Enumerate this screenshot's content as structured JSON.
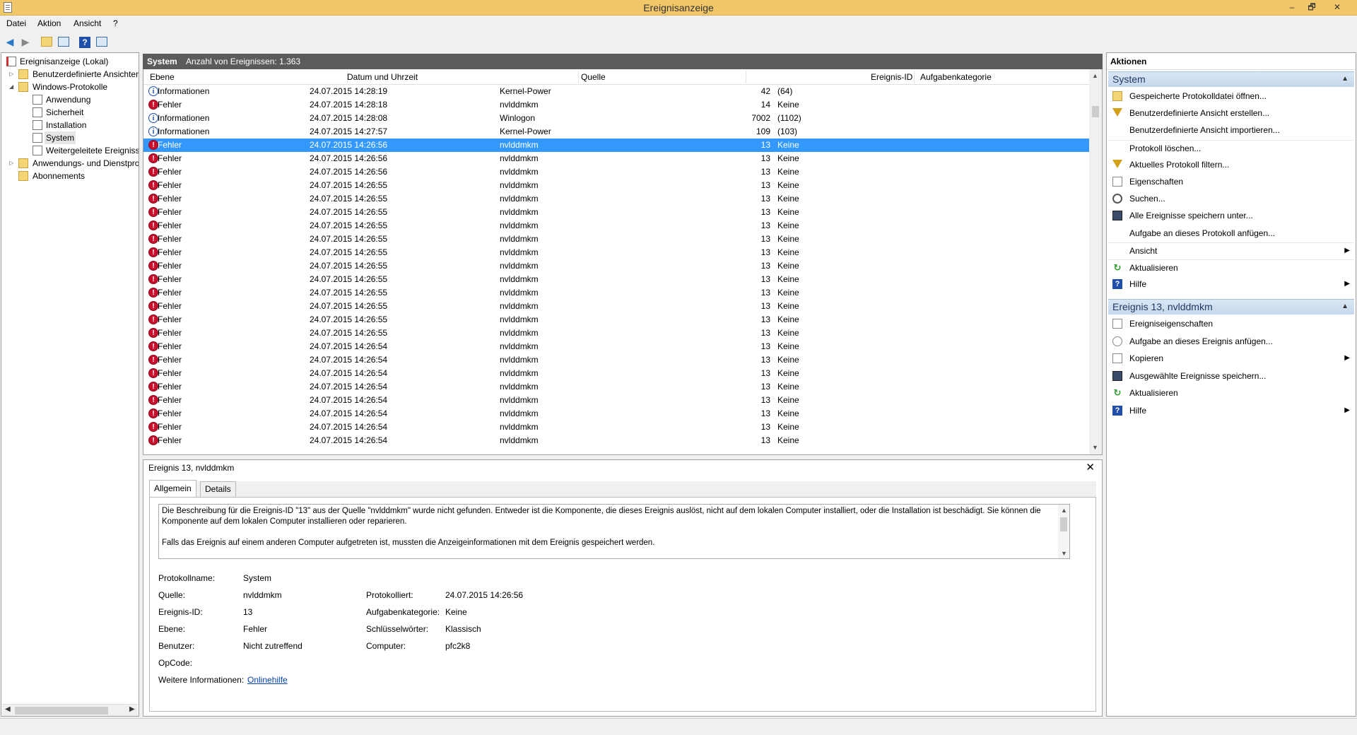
{
  "window": {
    "title": "Ereignisanzeige",
    "minimize": "–",
    "maximize": "🗗",
    "close": "✕"
  },
  "menu": [
    {
      "label": "Datei"
    },
    {
      "label": "Aktion"
    },
    {
      "label": "Ansicht"
    },
    {
      "label": "?"
    }
  ],
  "toolbar": {
    "back_icon": "arrow-left-icon",
    "forward_icon": "arrow-right-icon",
    "help_glyph": "?"
  },
  "tree": {
    "root": "Ereignisanzeige (Lokal)",
    "custom_views": "Benutzerdefinierte Ansichten",
    "windows_logs": "Windows-Protokolle",
    "logs": [
      "Anwendung",
      "Sicherheit",
      "Installation",
      "System",
      "Weitergeleitete Ereignisse"
    ],
    "app_logs": "Anwendungs- und Dienstprotokolle",
    "subscriptions": "Abonnements"
  },
  "list": {
    "header_title": "System",
    "header_count": "Anzahl von Ereignissen: 1.363",
    "columns": {
      "level": "Ebene",
      "date": "Datum und Uhrzeit",
      "source": "Quelle",
      "id": "Ereignis-ID",
      "category": "Aufgabenkategorie"
    },
    "rows": [
      {
        "type": "info",
        "level": "Informationen",
        "date": "24.07.2015 14:28:19",
        "source": "Kernel-Power",
        "id": "42",
        "category": "(64)"
      },
      {
        "type": "error",
        "level": "Fehler",
        "date": "24.07.2015 14:28:18",
        "source": "nvlddmkm",
        "id": "14",
        "category": "Keine"
      },
      {
        "type": "info",
        "level": "Informationen",
        "date": "24.07.2015 14:28:08",
        "source": "Winlogon",
        "id": "7002",
        "category": "(1102)"
      },
      {
        "type": "info",
        "level": "Informationen",
        "date": "24.07.2015 14:27:57",
        "source": "Kernel-Power",
        "id": "109",
        "category": "(103)"
      },
      {
        "type": "error",
        "level": "Fehler",
        "date": "24.07.2015 14:26:56",
        "source": "nvlddmkm",
        "id": "13",
        "category": "Keine",
        "selected": true
      },
      {
        "type": "error",
        "level": "Fehler",
        "date": "24.07.2015 14:26:56",
        "source": "nvlddmkm",
        "id": "13",
        "category": "Keine"
      },
      {
        "type": "error",
        "level": "Fehler",
        "date": "24.07.2015 14:26:56",
        "source": "nvlddmkm",
        "id": "13",
        "category": "Keine"
      },
      {
        "type": "error",
        "level": "Fehler",
        "date": "24.07.2015 14:26:55",
        "source": "nvlddmkm",
        "id": "13",
        "category": "Keine"
      },
      {
        "type": "error",
        "level": "Fehler",
        "date": "24.07.2015 14:26:55",
        "source": "nvlddmkm",
        "id": "13",
        "category": "Keine"
      },
      {
        "type": "error",
        "level": "Fehler",
        "date": "24.07.2015 14:26:55",
        "source": "nvlddmkm",
        "id": "13",
        "category": "Keine"
      },
      {
        "type": "error",
        "level": "Fehler",
        "date": "24.07.2015 14:26:55",
        "source": "nvlddmkm",
        "id": "13",
        "category": "Keine"
      },
      {
        "type": "error",
        "level": "Fehler",
        "date": "24.07.2015 14:26:55",
        "source": "nvlddmkm",
        "id": "13",
        "category": "Keine"
      },
      {
        "type": "error",
        "level": "Fehler",
        "date": "24.07.2015 14:26:55",
        "source": "nvlddmkm",
        "id": "13",
        "category": "Keine"
      },
      {
        "type": "error",
        "level": "Fehler",
        "date": "24.07.2015 14:26:55",
        "source": "nvlddmkm",
        "id": "13",
        "category": "Keine"
      },
      {
        "type": "error",
        "level": "Fehler",
        "date": "24.07.2015 14:26:55",
        "source": "nvlddmkm",
        "id": "13",
        "category": "Keine"
      },
      {
        "type": "error",
        "level": "Fehler",
        "date": "24.07.2015 14:26:55",
        "source": "nvlddmkm",
        "id": "13",
        "category": "Keine"
      },
      {
        "type": "error",
        "level": "Fehler",
        "date": "24.07.2015 14:26:55",
        "source": "nvlddmkm",
        "id": "13",
        "category": "Keine"
      },
      {
        "type": "error",
        "level": "Fehler",
        "date": "24.07.2015 14:26:55",
        "source": "nvlddmkm",
        "id": "13",
        "category": "Keine"
      },
      {
        "type": "error",
        "level": "Fehler",
        "date": "24.07.2015 14:26:55",
        "source": "nvlddmkm",
        "id": "13",
        "category": "Keine"
      },
      {
        "type": "error",
        "level": "Fehler",
        "date": "24.07.2015 14:26:54",
        "source": "nvlddmkm",
        "id": "13",
        "category": "Keine"
      },
      {
        "type": "error",
        "level": "Fehler",
        "date": "24.07.2015 14:26:54",
        "source": "nvlddmkm",
        "id": "13",
        "category": "Keine"
      },
      {
        "type": "error",
        "level": "Fehler",
        "date": "24.07.2015 14:26:54",
        "source": "nvlddmkm",
        "id": "13",
        "category": "Keine"
      },
      {
        "type": "error",
        "level": "Fehler",
        "date": "24.07.2015 14:26:54",
        "source": "nvlddmkm",
        "id": "13",
        "category": "Keine"
      },
      {
        "type": "error",
        "level": "Fehler",
        "date": "24.07.2015 14:26:54",
        "source": "nvlddmkm",
        "id": "13",
        "category": "Keine"
      },
      {
        "type": "error",
        "level": "Fehler",
        "date": "24.07.2015 14:26:54",
        "source": "nvlddmkm",
        "id": "13",
        "category": "Keine"
      },
      {
        "type": "error",
        "level": "Fehler",
        "date": "24.07.2015 14:26:54",
        "source": "nvlddmkm",
        "id": "13",
        "category": "Keine"
      },
      {
        "type": "error",
        "level": "Fehler",
        "date": "24.07.2015 14:26:54",
        "source": "nvlddmkm",
        "id": "13",
        "category": "Keine"
      }
    ]
  },
  "detail": {
    "title": "Ereignis 13, nvlddmkm",
    "close_glyph": "✕",
    "tabs": [
      "Allgemein",
      "Details"
    ],
    "description_p1": "Die Beschreibung für die Ereignis-ID \"13\" aus der Quelle \"nvlddmkm\" wurde nicht gefunden. Entweder ist die Komponente, die dieses Ereignis auslöst, nicht auf dem lokalen Computer installiert, oder die Installation ist beschädigt. Sie können die Komponente auf dem lokalen Computer installieren oder reparieren.",
    "description_p2": "Falls das Ereignis auf einem anderen Computer aufgetreten ist, mussten die Anzeigeinformationen mit dem Ereignis gespeichert werden.",
    "props": {
      "log_name_label": "Protokollname:",
      "log_name": "System",
      "source_label": "Quelle:",
      "source": "nvlddmkm",
      "logged_label": "Protokolliert:",
      "logged": "24.07.2015 14:26:56",
      "event_id_label": "Ereignis-ID:",
      "event_id": "13",
      "task_cat_label": "Aufgabenkategorie:",
      "task_cat": "Keine",
      "level_label": "Ebene:",
      "level": "Fehler",
      "keywords_label": "Schlüsselwörter:",
      "keywords": "Klassisch",
      "user_label": "Benutzer:",
      "user": "Nicht zutreffend",
      "computer_label": "Computer:",
      "computer": "pfc2k8",
      "opcode_label": "OpCode:",
      "more_info_label": "Weitere Informationen:",
      "more_info_link": "Onlinehilfe"
    }
  },
  "actions": {
    "header": "Aktionen",
    "section1": "System",
    "section1_items": [
      {
        "label": "Gespeicherte Protokolldatei öffnen...",
        "icon": "open-icon"
      },
      {
        "label": "Benutzerdefinierte Ansicht erstellen...",
        "icon": "filter-icon"
      },
      {
        "label": "Benutzerdefinierte Ansicht importieren...",
        "icon": ""
      },
      {
        "label": "Protokoll löschen...",
        "icon": ""
      },
      {
        "label": "Aktuelles Protokoll filtern...",
        "icon": "filter-icon"
      },
      {
        "label": "Eigenschaften",
        "icon": "page-icon"
      },
      {
        "label": "Suchen...",
        "icon": "find-icon"
      },
      {
        "label": "Alle Ereignisse speichern unter...",
        "icon": "save-icon"
      },
      {
        "label": "Aufgabe an dieses Protokoll anfügen...",
        "icon": ""
      },
      {
        "label": "Ansicht",
        "icon": "",
        "submenu": true
      },
      {
        "label": "Aktualisieren",
        "icon": "refresh-icon"
      },
      {
        "label": "Hilfe",
        "icon": "help-icon",
        "submenu": true
      }
    ],
    "section2": "Ereignis 13, nvlddmkm",
    "section2_items": [
      {
        "label": "Ereigniseigenschaften",
        "icon": "page-icon"
      },
      {
        "label": "Aufgabe an dieses Ereignis anfügen...",
        "icon": "task-icon"
      },
      {
        "label": "Kopieren",
        "icon": "page-icon",
        "submenu": true
      },
      {
        "label": "Ausgewählte Ereignisse speichern...",
        "icon": "save-icon"
      },
      {
        "label": "Aktualisieren",
        "icon": "refresh-icon"
      },
      {
        "label": "Hilfe",
        "icon": "help-icon",
        "submenu": true
      }
    ],
    "submenu_glyph": "▶",
    "collapse_glyph": "▲"
  }
}
